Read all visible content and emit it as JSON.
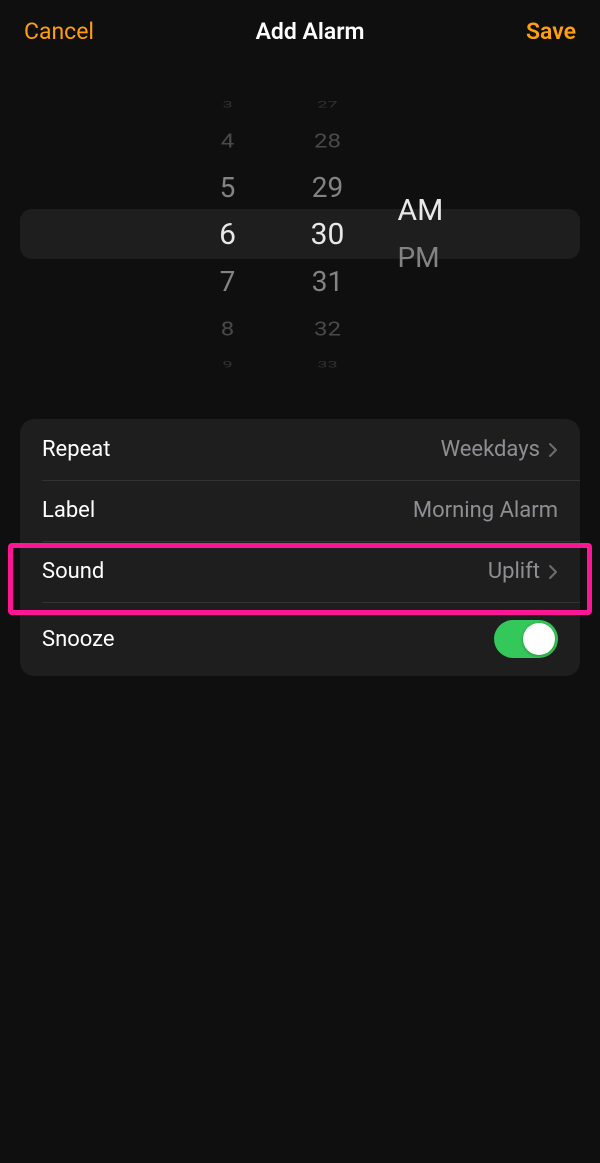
{
  "header": {
    "cancel": "Cancel",
    "title": "Add Alarm",
    "save": "Save"
  },
  "picker": {
    "hours": [
      "3",
      "4",
      "5",
      "6",
      "7",
      "8",
      "9"
    ],
    "minutes": [
      "27",
      "28",
      "29",
      "30",
      "31",
      "32",
      "33"
    ],
    "ampm": [
      "AM",
      "PM"
    ],
    "selected_hour": "6",
    "selected_minute": "30",
    "selected_ampm": "AM"
  },
  "settings": {
    "repeat_label": "Repeat",
    "repeat_value": "Weekdays",
    "label_label": "Label",
    "label_value": "Morning Alarm",
    "sound_label": "Sound",
    "sound_value": "Uplift",
    "snooze_label": "Snooze",
    "snooze_on": true
  }
}
